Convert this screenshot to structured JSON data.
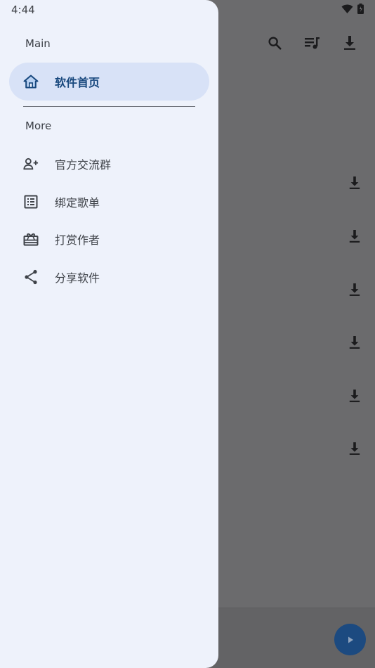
{
  "status_bar": {
    "time": "4:44",
    "icons": [
      "wifi-icon",
      "battery-icon"
    ]
  },
  "drawer": {
    "sections": [
      {
        "title": "Main"
      },
      {
        "title": "More"
      }
    ],
    "main_items": [
      {
        "label": "软件首页",
        "icon": "home-icon",
        "active": true
      }
    ],
    "more_items": [
      {
        "label": "官方交流群",
        "icon": "add-person-icon"
      },
      {
        "label": "绑定歌单",
        "icon": "list-alt-icon"
      },
      {
        "label": "打赏作者",
        "icon": "gift-icon"
      },
      {
        "label": "分享软件",
        "icon": "share-icon"
      }
    ]
  },
  "app_toolbar": {
    "icons": [
      "search-icon",
      "playlist-music-icon",
      "download-icon"
    ]
  },
  "colors": {
    "drawer_bg": "#eef2fb",
    "active_bg": "#d8e2f7",
    "active_text": "#17477d",
    "scrim": "#6b6b6d",
    "fab": "#1c4a80"
  }
}
